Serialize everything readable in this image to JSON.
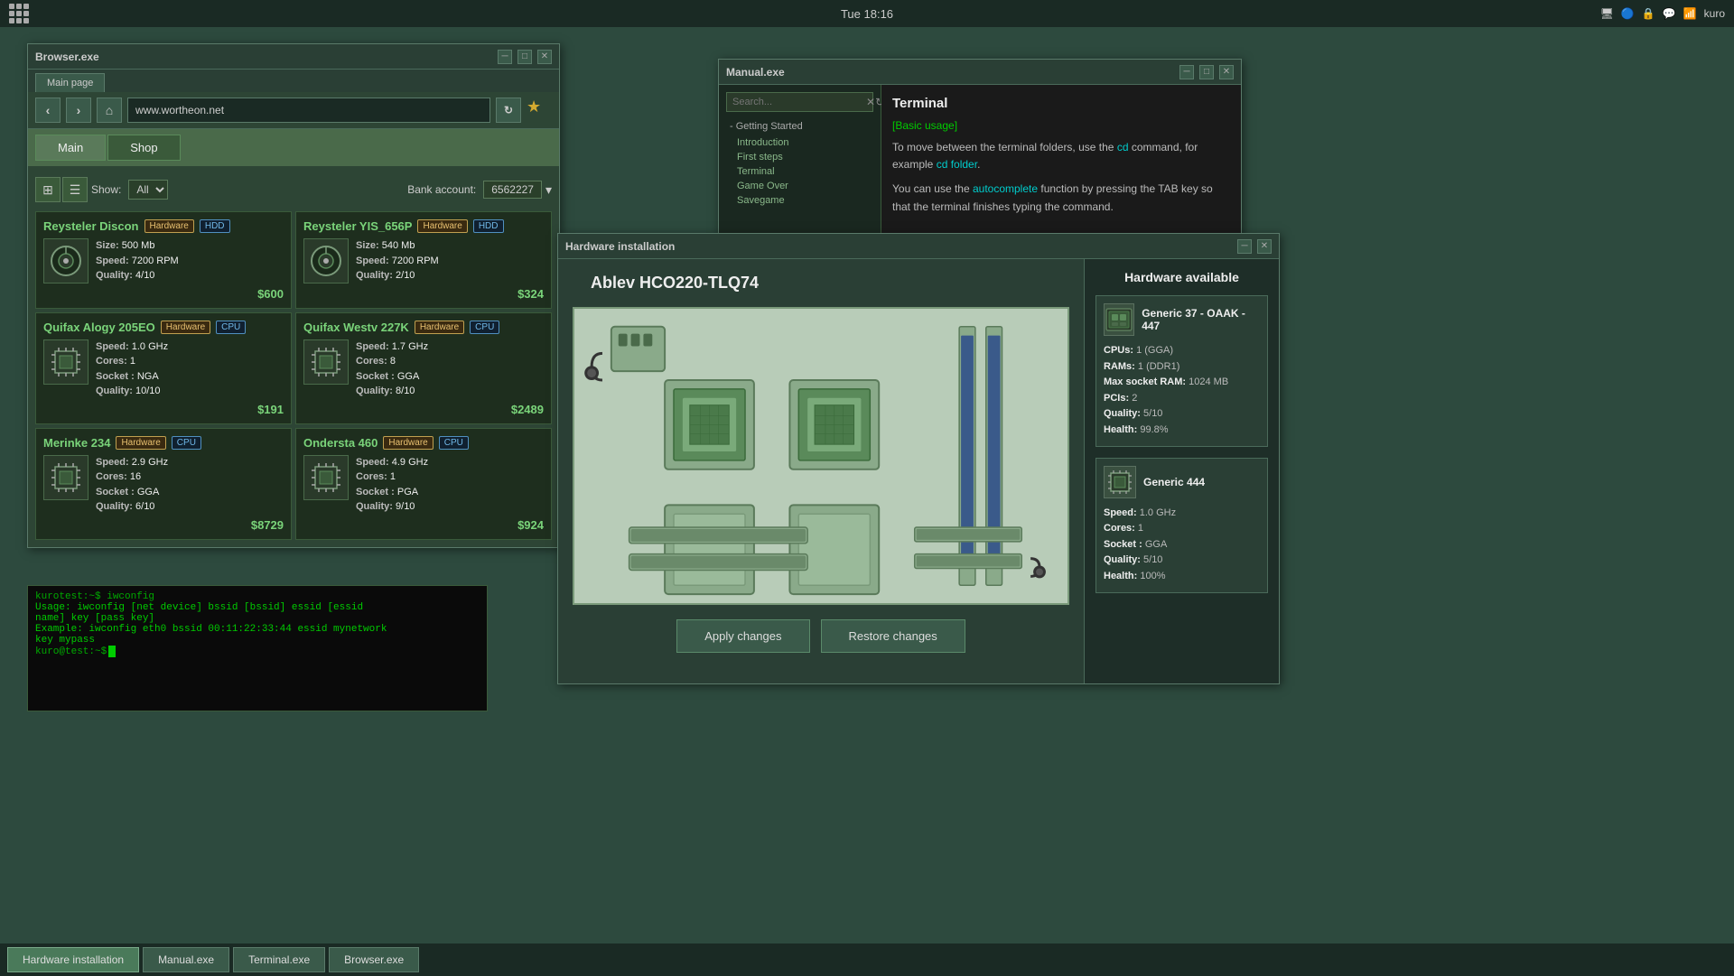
{
  "taskbar_top": {
    "time": "Tue 18:16",
    "user": "kuro"
  },
  "taskbar_bottom": {
    "buttons": [
      {
        "label": "Hardware installation",
        "active": true
      },
      {
        "label": "Manual.exe",
        "active": false
      },
      {
        "label": "Terminal.exe",
        "active": false
      },
      {
        "label": "Browser.exe",
        "active": false
      }
    ]
  },
  "browser": {
    "title": "Browser.exe",
    "tab": "Main page",
    "url": "www.wortheon.net",
    "nav": [
      "Main",
      "Shop"
    ],
    "show_label": "Show:",
    "show_value": "All",
    "bank_label": "Bank account:",
    "bank_value": "6562227",
    "items": [
      {
        "name": "Reysteler Discon",
        "tags": [
          "Hardware",
          "HDD"
        ],
        "size": "500 Mb",
        "speed": "7200 RPM",
        "quality": "4/10",
        "price": "$600"
      },
      {
        "name": "Reysteler YIS_656P",
        "tags": [
          "Hardware",
          "HDD"
        ],
        "size": "540 Mb",
        "speed": "7200 RPM",
        "quality": "2/10",
        "price": "$324"
      },
      {
        "name": "Quifax Alogy 205EO",
        "tags": [
          "Hardware",
          "CPU"
        ],
        "speed": "1.0 GHz",
        "cores": "1",
        "socket": "NGA",
        "quality": "10/10",
        "price": "$191"
      },
      {
        "name": "Quifax Westv 227K",
        "tags": [
          "Hardware",
          "CPU"
        ],
        "speed": "1.7 GHz",
        "cores": "8",
        "socket": "GGA",
        "quality": "8/10",
        "price": "$2489"
      },
      {
        "name": "Merinke 234",
        "tags": [
          "Hardware",
          "CPU"
        ],
        "speed": "2.9 GHz",
        "cores": "16",
        "socket": "GGA",
        "quality": "6/10",
        "price": "$8729"
      },
      {
        "name": "Ondersta 460",
        "tags": [
          "Hardware",
          "CPU"
        ],
        "speed": "4.9 GHz",
        "cores": "1",
        "socket": "PGA",
        "quality": "9/10",
        "price": "$924"
      }
    ]
  },
  "terminal": {
    "lines": [
      "kurotest:~$ iwconfig",
      "Usage: iwconfig [net device] bssid [bssid] essid [essid",
      "name] key [pass key]",
      "Example: iwconfig eth0 bssid 00:11:22:33:44 essid mynetwork",
      "key mypass",
      "kuro@test:~$"
    ]
  },
  "manual": {
    "title": "Manual.exe",
    "search_placeholder": "Search...",
    "section": "Getting Started",
    "nav_items": [
      "Introduction",
      "First steps",
      "Terminal",
      "Game Over",
      "Savegame"
    ],
    "body_title": "Terminal",
    "highlight_label": "[Basic usage]",
    "text1": "To move between the terminal folders, use the",
    "cmd1": "cd",
    "text2": "command, for example",
    "cmd2": "cd folder",
    "text3": "You can use the",
    "highlight2": "autocomplete",
    "text4": "function by pressing the TAB key so that the terminal finishes typing the command."
  },
  "hardware": {
    "title": "Hardware installation",
    "board_name": "Ablev HCO220-TLQ74",
    "apply_btn": "Apply changes",
    "restore_btn": "Restore changes",
    "sidebar_title": "Hardware available",
    "items": [
      {
        "name": "Generic 37 - OAAK - 447",
        "cpus": "1 (GGA)",
        "rams": "1 (DDR1)",
        "max_socket_ram": "1024 MB",
        "pcis": "2",
        "quality": "5/10",
        "health": "99.8%"
      },
      {
        "name": "Generic 444",
        "speed": "1.0 GHz",
        "cores": "1",
        "socket": "GGA",
        "quality": "5/10",
        "health": "100%"
      }
    ]
  }
}
